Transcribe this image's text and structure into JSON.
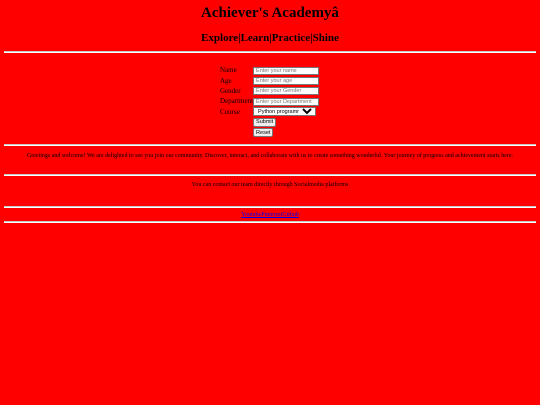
{
  "header": {
    "title": "Achiever's Academyâ",
    "tagline": "Explore|Learn|Practice|Shine"
  },
  "form": {
    "name_label": "Name",
    "name_placeholder": "Enter your name",
    "age_label": "Age",
    "age_placeholder": "Enter your age",
    "gender_label": "Gender",
    "gender_placeholder": "Enter your Gender",
    "department_label": "Department",
    "department_placeholder": "Enter your Department",
    "course_label": "Course",
    "course_selected": "Python programming",
    "submit_label": "Submit",
    "reset_label": "Reset"
  },
  "greeting": "Greetings and welcome! We are delighted to see you join our community. Discover, interact, and collaborate with us to create something wonderful. Your journey of progress and achievement starts here.",
  "contact": "You can contact our team directly through Socialmedia platforms",
  "links": {
    "youtube": "Youtube",
    "pinterest": "Pinterest",
    "github": "Github"
  }
}
